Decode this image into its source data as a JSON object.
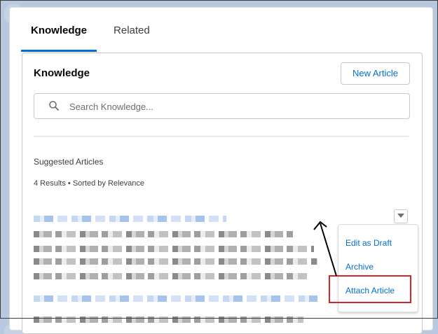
{
  "tabs": [
    {
      "label": "Knowledge",
      "active": true
    },
    {
      "label": "Related",
      "active": false
    }
  ],
  "panel": {
    "title": "Knowledge",
    "new_article_label": "New Article"
  },
  "search": {
    "placeholder": "Search Knowledge...",
    "value": "",
    "icon": "search-icon"
  },
  "suggested": {
    "label": "Suggested Articles",
    "results": "4 Results • Sorted by Relevance"
  },
  "menu": {
    "toggle_icon": "chevron-down-icon",
    "items": [
      {
        "label": "Edit as Draft"
      },
      {
        "label": "Archive"
      },
      {
        "label": "Attach Article"
      }
    ]
  },
  "colors": {
    "accent": "#0070d2",
    "highlight": "#d7232a"
  }
}
